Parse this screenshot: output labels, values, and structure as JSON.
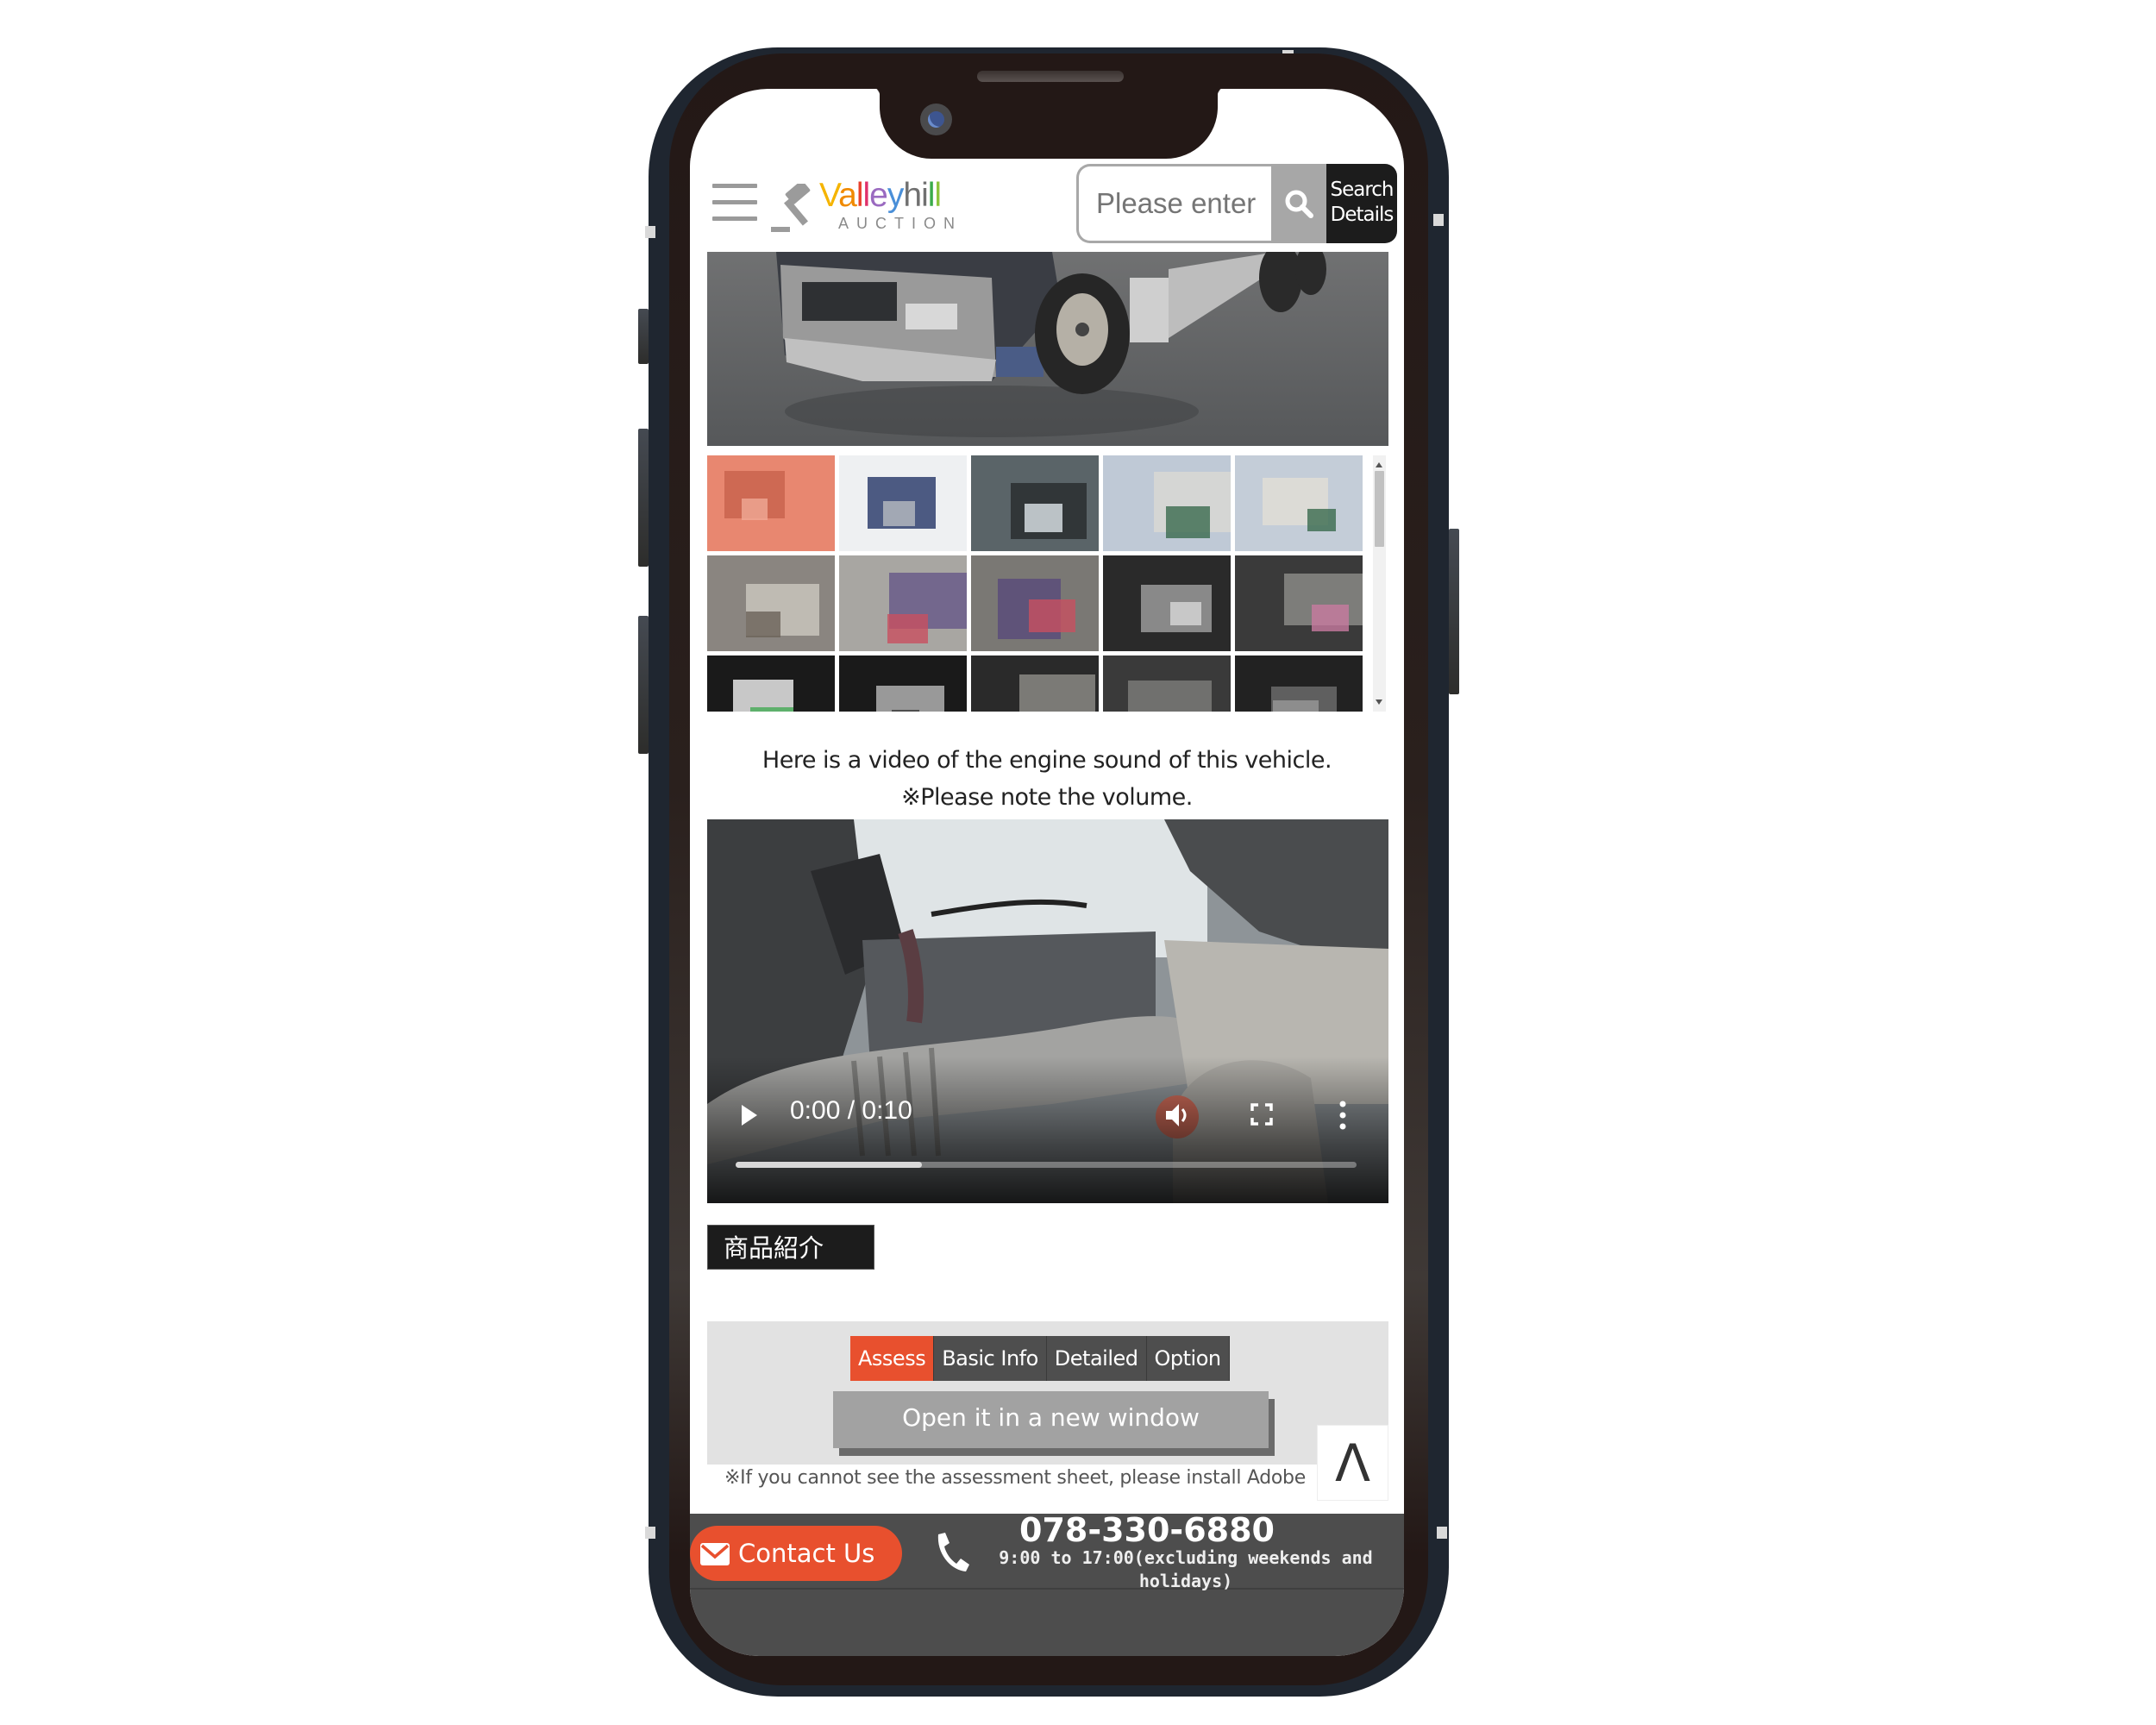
{
  "header": {
    "logo_text": "Valleyhill",
    "logo_letters": [
      {
        "ch": "V",
        "color": "#f5b400"
      },
      {
        "ch": "a",
        "color": "#f08a00"
      },
      {
        "ch": "l",
        "color": "#e8412c"
      },
      {
        "ch": "l",
        "color": "#e0306a"
      },
      {
        "ch": "e",
        "color": "#9a6ac0"
      },
      {
        "ch": "y",
        "color": "#4a8fd8"
      },
      {
        "ch": "h",
        "color": "#707070"
      },
      {
        "ch": "i",
        "color": "#707070"
      },
      {
        "ch": "l",
        "color": "#3aab4a"
      },
      {
        "ch": "l",
        "color": "#8cc43c"
      }
    ],
    "logo_subtitle": "AUCTION",
    "search_placeholder": "Please enter",
    "search_details_line1": "Search",
    "search_details_line2": "Details"
  },
  "gallery": {
    "thumbnail_count_visible": 15,
    "thumbnails": [
      {
        "subject": "truck-front-left-selected",
        "tint": "#e88770"
      },
      {
        "subject": "truck-front-right"
      },
      {
        "subject": "windshield"
      },
      {
        "subject": "truck-rear-right"
      },
      {
        "subject": "truck-rear-left"
      },
      {
        "subject": "cargo-interior"
      },
      {
        "subject": "driver-seat"
      },
      {
        "subject": "passenger-seat"
      },
      {
        "subject": "service-parts-id-plate"
      },
      {
        "subject": "cabin-floor-shifter"
      },
      {
        "subject": "speedometer"
      },
      {
        "subject": "wheel"
      },
      {
        "subject": "undercarriage-1"
      },
      {
        "subject": "undercarriage-2"
      },
      {
        "subject": "undercarriage-3"
      }
    ]
  },
  "video_section": {
    "note_line1": "Here is a video of the engine sound of this vehicle.",
    "note_line2": "※Please note the volume.",
    "current_time": "0:00",
    "duration": "0:10",
    "time_display": "0:00 / 0:10",
    "buffered_fraction": 0.3
  },
  "product_section": {
    "label": "商品紹介",
    "tabs": [
      {
        "label": "Assess",
        "active": true
      },
      {
        "label": "Basic Info",
        "active": false
      },
      {
        "label": "Detailed",
        "active": false
      },
      {
        "label": "Option",
        "active": false
      }
    ],
    "open_button": "Open it in a new window",
    "pdf_note": "※If you cannot see the assessment sheet, please install Adobe",
    "to_top_label": "Λ"
  },
  "footer": {
    "contact_label": "Contact Us",
    "phone_number": "078-330-6880",
    "hours_line1": "9:00 to 17:00(excluding weekends and",
    "hours_line2": "holidays)"
  },
  "colors": {
    "accent": "#e8502e",
    "footer_bg": "#4d4d4d",
    "header_dark": "#1c1c1c"
  }
}
